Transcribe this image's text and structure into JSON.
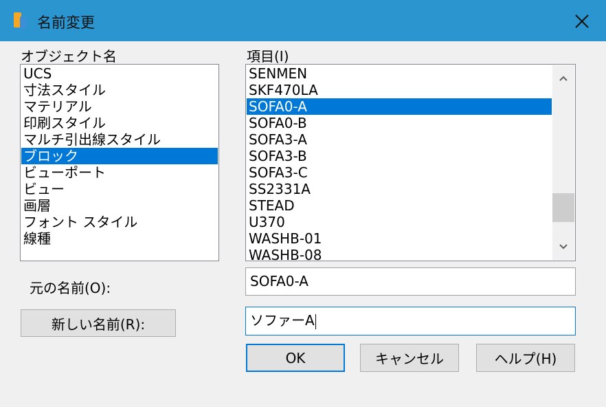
{
  "window": {
    "title": "名前変更"
  },
  "left_panel": {
    "label": "オブジェクト名",
    "items": [
      "UCS",
      "寸法スタイル",
      "マテリアル",
      "印刷スタイル",
      "マルチ引出線スタイル",
      "ブロック",
      "ビューポート",
      "ビュー",
      "画層",
      "フォント スタイル",
      "線種"
    ],
    "selected": "ブロック"
  },
  "right_panel": {
    "label": "項目(I)",
    "items": [
      "SENMEN",
      "SKF470LA",
      "SOFA0-A",
      "SOFA0-B",
      "SOFA3-A",
      "SOFA3-B",
      "SOFA3-C",
      "SS2331A",
      "STEAD",
      "U370",
      "WASHB-01",
      "WASHB-08"
    ],
    "selected": "SOFA0-A"
  },
  "old_name": {
    "label": "元の名前(O):",
    "value": "SOFA0-A"
  },
  "new_name": {
    "button_label": "新しい名前(R):",
    "value": "ソファーA"
  },
  "buttons": {
    "ok": "OK",
    "cancel": "キャンセル",
    "help": "ヘルプ(H)"
  },
  "colors": {
    "titlebar": "#2b95cf",
    "selection": "#0078d7",
    "focus_border": "#0078d7"
  }
}
